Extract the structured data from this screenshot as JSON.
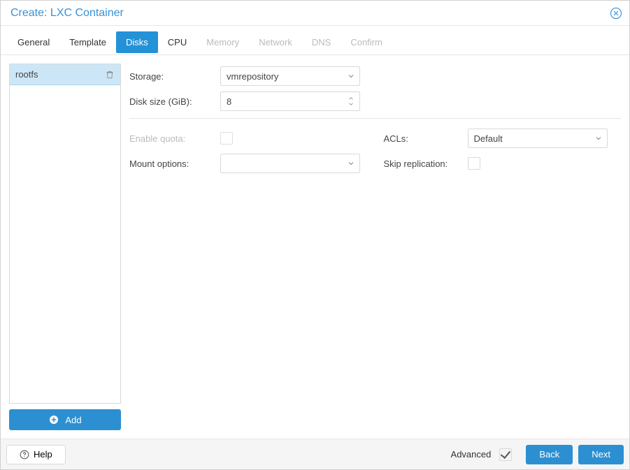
{
  "window": {
    "title": "Create: LXC Container"
  },
  "tabs": [
    {
      "label": "General",
      "state": "normal"
    },
    {
      "label": "Template",
      "state": "normal"
    },
    {
      "label": "Disks",
      "state": "active"
    },
    {
      "label": "CPU",
      "state": "normal"
    },
    {
      "label": "Memory",
      "state": "disabled"
    },
    {
      "label": "Network",
      "state": "disabled"
    },
    {
      "label": "DNS",
      "state": "disabled"
    },
    {
      "label": "Confirm",
      "state": "disabled"
    }
  ],
  "disks": {
    "items": [
      {
        "name": "rootfs",
        "selected": true
      }
    ],
    "add_label": "Add"
  },
  "form": {
    "storage_label": "Storage:",
    "storage_value": "vmrepository",
    "disk_size_label": "Disk size (GiB):",
    "disk_size_value": "8",
    "enable_quota_label": "Enable quota:",
    "enable_quota_disabled": true,
    "mount_options_label": "Mount options:",
    "mount_options_value": "",
    "acls_label": "ACLs:",
    "acls_value": "Default",
    "skip_replication_label": "Skip replication:",
    "skip_replication_checked": false
  },
  "footer": {
    "help_label": "Help",
    "advanced_label": "Advanced",
    "advanced_checked": true,
    "back_label": "Back",
    "next_label": "Next"
  }
}
